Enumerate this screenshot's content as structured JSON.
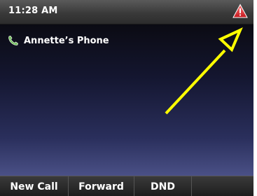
{
  "status_bar": {
    "time": "11:28 AM",
    "alert_icon": "warning-triangle-icon",
    "alert_color": "#e8333a"
  },
  "line": {
    "label": "Annette’s Phone",
    "icon": "phone-handset-icon",
    "icon_color": "#4caf50"
  },
  "annotation": {
    "arrow_color": "#ffff00"
  },
  "softkeys": [
    "New Call",
    "Forward",
    "DND",
    ""
  ]
}
